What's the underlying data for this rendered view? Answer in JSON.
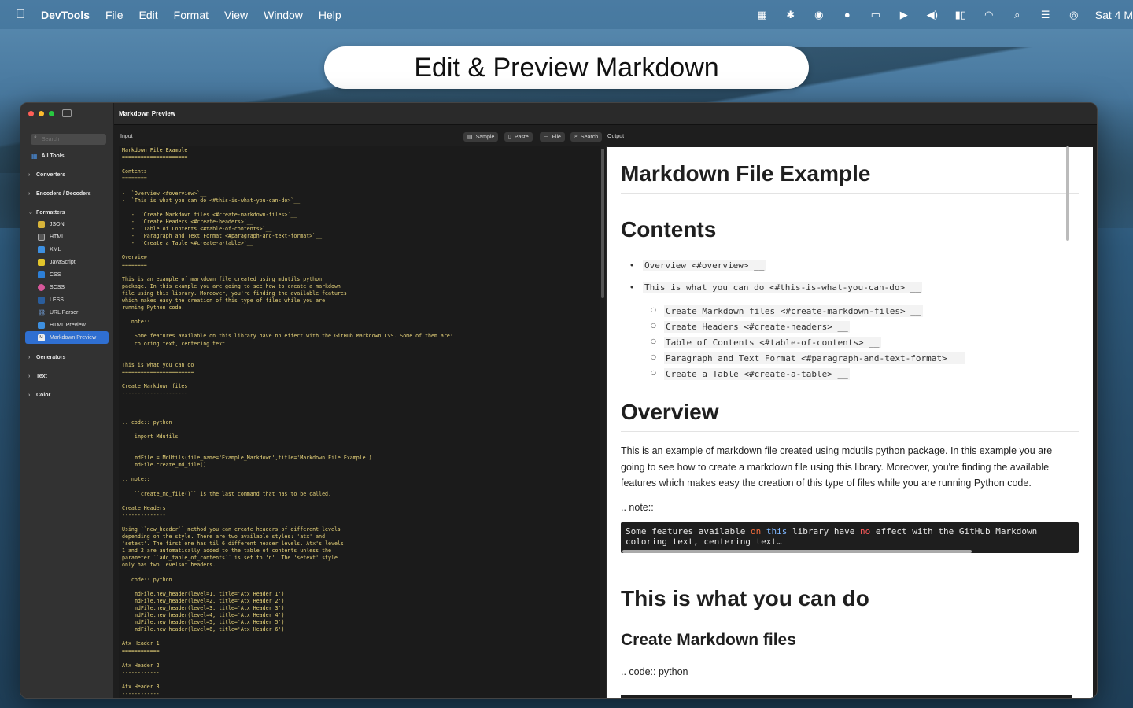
{
  "menubar": {
    "app": "DevTools",
    "items": [
      "File",
      "Edit",
      "Format",
      "View",
      "Window",
      "Help"
    ],
    "clock": "Sat 4 M"
  },
  "headline": "Edit & Preview Markdown",
  "sidebar": {
    "search_placeholder": "Search",
    "all_tools": "All Tools",
    "groups": {
      "converters": "Converters",
      "encoders": "Encoders / Decoders",
      "formatters": "Formatters",
      "generators": "Generators",
      "text": "Text",
      "color": "Color"
    },
    "formatters": [
      "JSON",
      "HTML",
      "XML",
      "JavaScript",
      "CSS",
      "SCSS",
      "LESS",
      "URL Parser",
      "HTML Preview",
      "Markdown Preview"
    ]
  },
  "window": {
    "title": "Markdown Preview",
    "input_label": "Input",
    "output_label": "Output",
    "buttons": {
      "sample": "Sample",
      "paste": "Paste",
      "file": "File",
      "search": "Search"
    }
  },
  "editor_text": "Markdown File Example\n=====================\n\nContents\n========\n\n-  `Overview <#overview>`__\n-  `This is what you can do <#this-is-what-you-can-do>`__\n\n   -  `Create Markdown files <#create-markdown-files>`__\n   -  `Create Headers <#create-headers>`__\n   -  `Table of Contents <#table-of-contents>`__\n   -  `Paragraph and Text Format <#paragraph-and-text-format>`__\n   -  `Create a Table <#create-a-table>`__\n\nOverview\n========\n\nThis is an example of markdown file created using mdutils python\npackage. In this example you are going to see how to create a markdown\nfile using this library. Moreover, you're finding the available features\nwhich makes easy the creation of this type of files while you are\nrunning Python code.\n\n.. note::\n\n    Some features available on this library have no effect with the GitHub Markdown CSS. Some of them are:\n    coloring text, centering text…\n\n\nThis is what you can do\n=======================\n\nCreate Markdown files\n---------------------\n\n\n\n.. code:: python\n\n    import Mdutils\n\n\n    mdFile = MdUtils(file_name='Example_Markdown',title='Markdown File Example')\n    mdFile.create_md_file()\n\n.. note::\n\n    ``create_md_file()`` is the last command that has to be called.\n\nCreate Headers\n--------------\n\nUsing ``new_header`` method you can create headers of different levels\ndepending on the style. There are two available styles: 'atx' and\n'setext'. The first one has til 6 different header levels. Atx's levels\n1 and 2 are automatically added to the table of contents unless the\nparameter ``add_table_of_contents`` is set to 'n'. The 'setext' style\nonly has two levelsof headers.\n\n.. code:: python\n\n    mdFile.new_header(level=1, title='Atx Header 1')\n    mdFile.new_header(level=2, title='Atx Header 2')\n    mdFile.new_header(level=3, title='Atx Header 3')\n    mdFile.new_header(level=4, title='Atx Header 4')\n    mdFile.new_header(level=5, title='Atx Header 5')\n    mdFile.new_header(level=6, title='Atx Header 6')\n\nAtx Header 1\n============\n\nAtx Header 2\n------------\n\nAtx Header 3\n------------",
  "preview": {
    "h1_title": "Markdown File Example",
    "h1_contents": "Contents",
    "toc": [
      "Overview <#overview> __",
      "This is what you can do <#this-is-what-you-can-do> __"
    ],
    "toc_sub": [
      "Create Markdown files <#create-markdown-files> __",
      "Create Headers <#create-headers> __",
      "Table of Contents <#table-of-contents> __",
      "Paragraph and Text Format <#paragraph-and-text-format> __",
      "Create a Table <#create-a-table> __"
    ],
    "h1_overview": "Overview",
    "overview_text": "This is an example of markdown file created using mdutils python package. In this example you are going to see how to create a markdown file using this library. Moreover, you're finding the available features which makes easy the creation of this type of files while you are running Python code.",
    "note_label": ".. note::",
    "code_line1_a": "Some features available ",
    "code_line1_on": "on",
    "code_line1_b": " ",
    "code_line1_this": "this",
    "code_line1_c": " library have ",
    "code_line1_no": "no",
    "code_line1_d": " effect with the GitHub Markdown",
    "code_line2": "coloring text, centering text…",
    "h1_what": "This is what you can do",
    "h2_create": "Create Markdown files",
    "code_label": ".. code:: python"
  }
}
